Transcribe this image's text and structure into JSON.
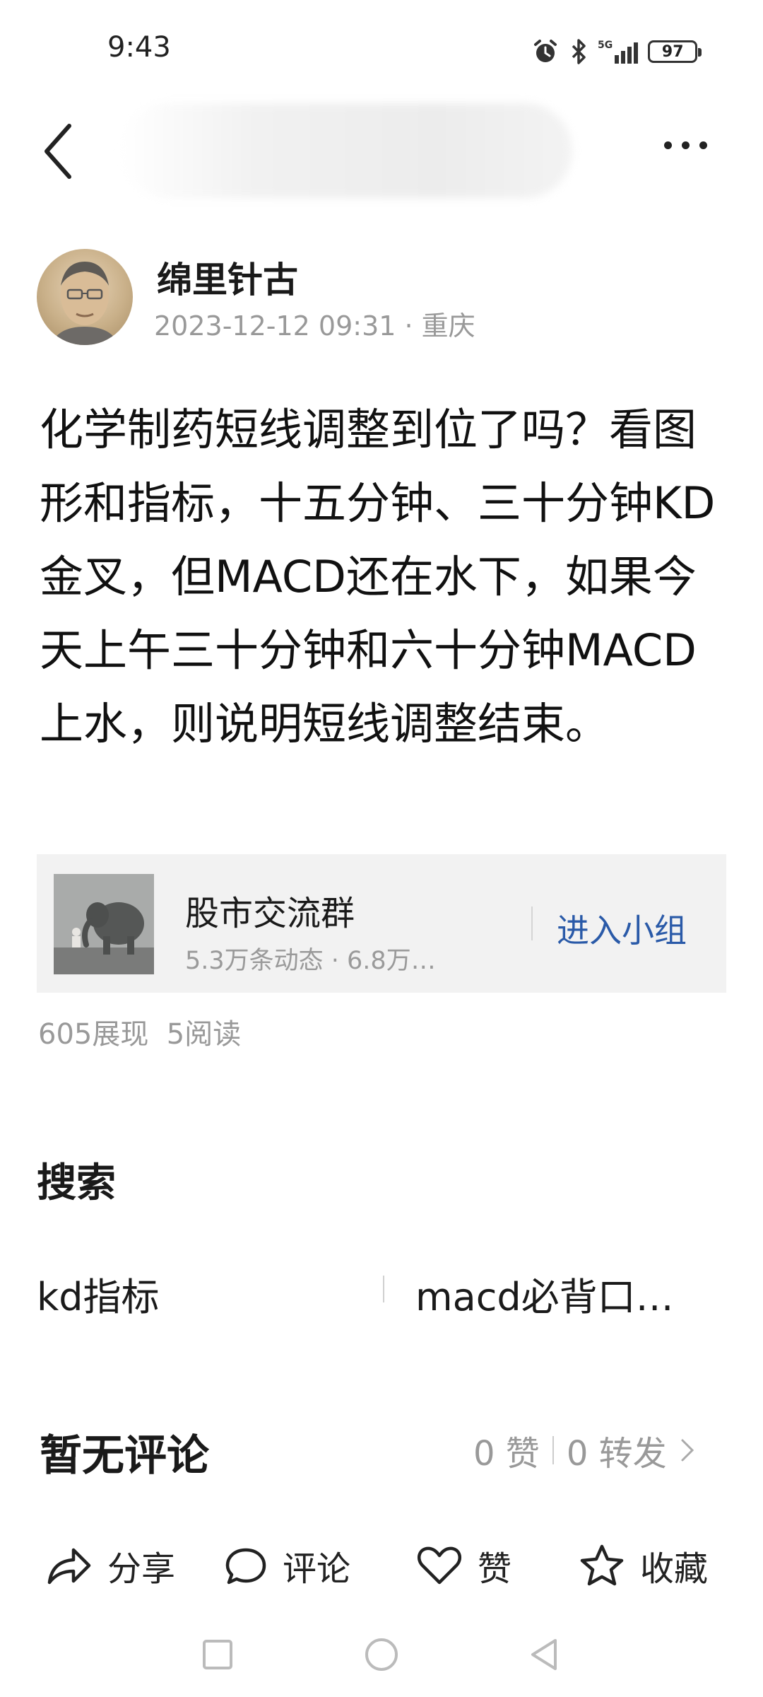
{
  "status_bar": {
    "time": "9:43",
    "network": "5G",
    "battery": "97"
  },
  "header": {
    "back_icon": "chevron-left-icon",
    "more_icon": "more-horizontal-icon"
  },
  "author": {
    "name": "绵里针古",
    "date": "2023-12-12 09:31",
    "location": "重庆",
    "meta": "2023-12-12 09:31 · 重庆"
  },
  "post": {
    "text": "化学制药短线调整到位了吗？看图形和指标，十五分钟、三十分钟KD金叉，但MACD还在水下，如果今天上午三十分钟和六十分钟MACD上水，则说明短线调整结束。"
  },
  "group": {
    "name": "股市交流群",
    "subtitle": "5.3万条动态 · 6.8万…",
    "join_label": "进入小组"
  },
  "stats": {
    "text": "605展现  5阅读"
  },
  "search": {
    "title": "搜索",
    "items": [
      "kd指标",
      "macd必背口…"
    ]
  },
  "comments": {
    "title": "暂无评论",
    "likes": "0 赞",
    "reposts": "0 转发"
  },
  "action_bar": {
    "share": "分享",
    "comment": "评论",
    "like": "赞",
    "favorite": "收藏"
  },
  "colors": {
    "link_blue": "#2a5aa8",
    "meta_gray": "#999999",
    "card_bg": "#f2f2f2"
  }
}
